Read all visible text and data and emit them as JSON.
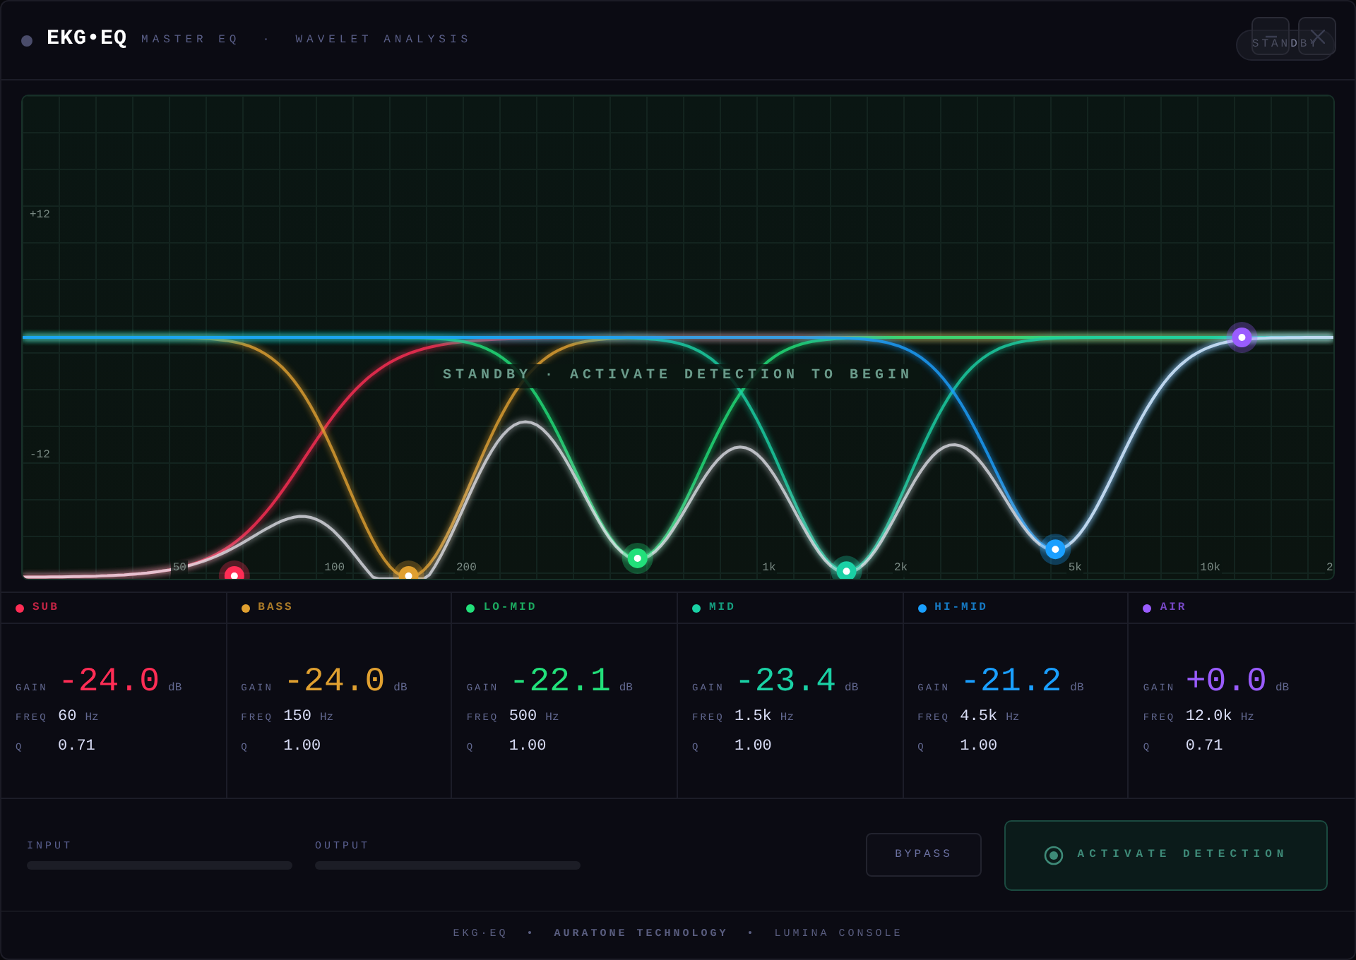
{
  "header": {
    "title": "EKG•EQ",
    "subtitle": "MASTER EQ  ·  WAVELET ANALYSIS",
    "status": "STANDBY",
    "window_buttons": [
      {
        "kind": "minimize"
      },
      {
        "kind": "close"
      }
    ]
  },
  "chart": {
    "message": "STANDBY · ACTIVATE DETECTION TO BEGIN",
    "y_labels": [
      "+12",
      "-12"
    ],
    "x_labels": [
      "50",
      "100",
      "200",
      "1k",
      "2k",
      "5k",
      "10k",
      "2"
    ]
  },
  "bands": [
    {
      "name": "SUB",
      "color": "#ff2d55",
      "gain": "-24.0",
      "freq": "60",
      "q": "0.71",
      "gain_label": "GAIN",
      "gain_unit": "dB",
      "freq_label": "FREQ",
      "freq_unit": "Hz",
      "q_label": "Q"
    },
    {
      "name": "BASS",
      "color": "#e0a030",
      "gain": "-24.0",
      "freq": "150",
      "q": "1.00",
      "gain_label": "GAIN",
      "gain_unit": "dB",
      "freq_label": "FREQ",
      "freq_unit": "Hz",
      "q_label": "Q"
    },
    {
      "name": "LO-MID",
      "color": "#22e07a",
      "gain": "-22.1",
      "freq": "500",
      "q": "1.00",
      "gain_label": "GAIN",
      "gain_unit": "dB",
      "freq_label": "FREQ",
      "freq_unit": "Hz",
      "q_label": "Q"
    },
    {
      "name": "MID",
      "color": "#1ad1a5",
      "gain": "-23.4",
      "freq": "1.5k",
      "q": "1.00",
      "gain_label": "GAIN",
      "gain_unit": "dB",
      "freq_label": "FREQ",
      "freq_unit": "Hz",
      "q_label": "Q"
    },
    {
      "name": "HI-MID",
      "color": "#1a9fff",
      "gain": "-21.2",
      "freq": "4.5k",
      "q": "1.00",
      "gain_label": "GAIN",
      "gain_unit": "dB",
      "freq_label": "FREQ",
      "freq_unit": "Hz",
      "q_label": "Q"
    },
    {
      "name": "AIR",
      "color": "#9a5cff",
      "gain": "+0.0",
      "freq": "12.0k",
      "q": "0.71",
      "gain_label": "GAIN",
      "gain_unit": "dB",
      "freq_label": "FREQ",
      "freq_unit": "Hz",
      "q_label": "Q"
    }
  ],
  "meters": [
    {
      "label": "INPUT",
      "level": 0
    },
    {
      "label": "OUTPUT",
      "level": 0
    }
  ],
  "buttons": [
    {
      "kind": "bypass",
      "label": "BYPASS"
    },
    {
      "kind": "activate",
      "label": "ACTIVATE DETECTION"
    }
  ],
  "footer": "EKG·EQ  •  **AURATONE TECHNOLOGY**  •  LUMINA CONSOLE"
}
